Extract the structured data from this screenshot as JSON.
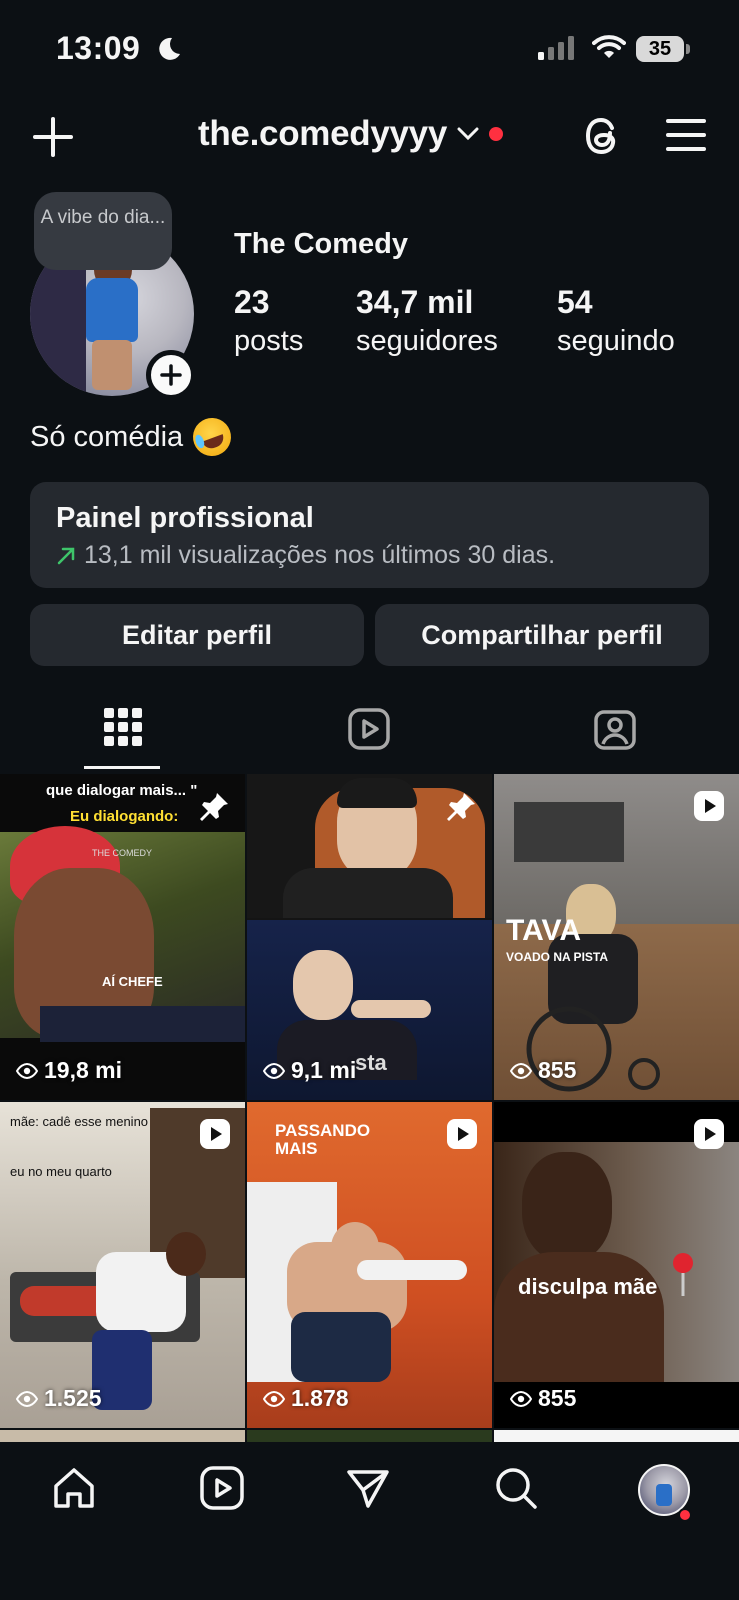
{
  "status_bar": {
    "time": "13:09",
    "battery": "35"
  },
  "header": {
    "username": "the.comedyyyy"
  },
  "profile": {
    "note": "A vibe do dia...",
    "display_name": "The Comedy",
    "posts_count": "23",
    "posts_label": "posts",
    "followers_count": "34,7 mil",
    "followers_label": "seguidores",
    "following_count": "54",
    "following_label": "seguindo",
    "bio": "Só comédia"
  },
  "pro_panel": {
    "title": "Painel profissional",
    "subtitle": "13,1 mil visualizações nos últimos 30 dias."
  },
  "actions": {
    "edit": "Editar perfil",
    "share": "Compartilhar perfil"
  },
  "posts": [
    {
      "views": "19,8 mi",
      "pinned": true,
      "caption_top": "que dialogar mais... \"",
      "caption_yellow": "Eu dialogando:",
      "caption_small": "AÍ CHEFE",
      "watermark": "THE COMEDY"
    },
    {
      "views": "9,1 mi",
      "pinned": true,
      "overlay": "sta"
    },
    {
      "views": "855",
      "reel": true,
      "caption_big": "TAVA",
      "caption_small": "VOADO NA PISTA"
    },
    {
      "views": "1.525",
      "reel": true,
      "caption_1": "mãe: cadê esse menino",
      "caption_2": "eu no meu quarto"
    },
    {
      "views": "1.878",
      "reel": true,
      "caption": "PASSANDO MAIS"
    },
    {
      "views": "855",
      "reel": true,
      "caption": "disculpa mãe"
    }
  ]
}
